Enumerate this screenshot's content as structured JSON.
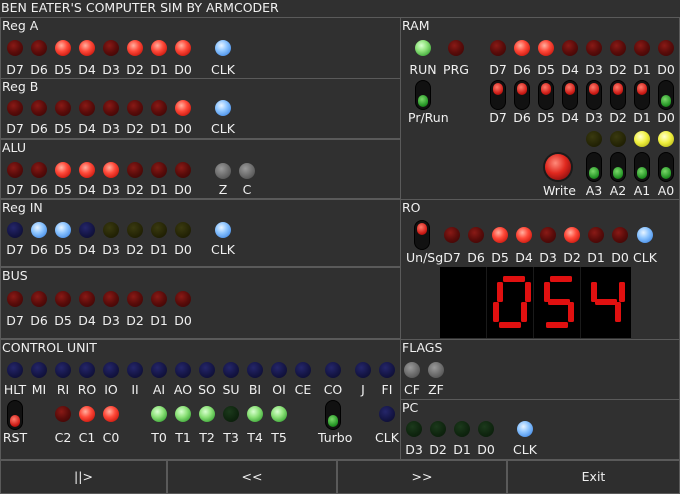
{
  "app": {
    "title": "BEN EATER'S COMPUTER SIM BY ARMCODER"
  },
  "colors": {
    "led_red_on": "#ff4a3a",
    "led_blue_on": "#8cc4ff",
    "led_green_on": "#8ee27a",
    "led_yellow_on": "#f0f040",
    "display_red": "#e01010",
    "background": "#303030"
  },
  "bit_labels": [
    "D7",
    "D6",
    "D5",
    "D4",
    "D3",
    "D2",
    "D1",
    "D0"
  ],
  "reg_a": {
    "title": "Reg A",
    "bits": [
      0,
      0,
      1,
      1,
      0,
      1,
      1,
      1
    ],
    "clk_label": "CLK",
    "clk": 1
  },
  "reg_b": {
    "title": "Reg B",
    "bits": [
      0,
      0,
      0,
      0,
      0,
      0,
      0,
      1
    ],
    "clk_label": "CLK",
    "clk": 1
  },
  "alu": {
    "title": "ALU",
    "bits": [
      0,
      0,
      1,
      1,
      1,
      0,
      0,
      0
    ],
    "z_label": "Z",
    "c_label": "C"
  },
  "reg_in": {
    "title": "Reg IN",
    "bits": [
      0,
      1,
      1,
      0,
      0,
      0,
      0,
      0
    ],
    "clk_label": "CLK",
    "clk": 1
  },
  "bus": {
    "title": "BUS",
    "bits": [
      0,
      0,
      0,
      0,
      0,
      0,
      0,
      0
    ]
  },
  "ram": {
    "title": "RAM",
    "run_label": "RUN",
    "prg_label": "PRG",
    "data_bits": [
      0,
      1,
      1,
      0,
      0,
      0,
      0,
      0
    ],
    "switch_bits": [
      1,
      1,
      1,
      1,
      1,
      1,
      1,
      0
    ],
    "pr_run_label": "Pr/Run",
    "write_label": "Write",
    "addr_labels": [
      "A3",
      "A2",
      "A1",
      "A0"
    ],
    "addr_bits": [
      0,
      0,
      1,
      1
    ]
  },
  "ro": {
    "title": "RO",
    "unsg_label": "Un/Sg",
    "bits": [
      0,
      0,
      1,
      1,
      0,
      1,
      0,
      0
    ],
    "clk_label": "CLK",
    "display_digits": [
      "",
      "0",
      "5",
      "4"
    ]
  },
  "control": {
    "title": "CONTROL UNIT",
    "signals": [
      "HLT",
      "MI",
      "RI",
      "RO",
      "IO",
      "II",
      "AI",
      "AO",
      "SO",
      "SU",
      "BI",
      "OI",
      "CE",
      "CO",
      "J",
      "FI"
    ],
    "rst_label": "RST",
    "counter_labels": [
      "C2",
      "C1",
      "C0"
    ],
    "counter_bits": [
      0,
      1,
      1
    ],
    "t_labels": [
      "T0",
      "T1",
      "T2",
      "T3",
      "T4",
      "T5"
    ],
    "t_bits": [
      1,
      1,
      1,
      0,
      1,
      1
    ],
    "turbo_label": "Turbo",
    "clk_label": "CLK"
  },
  "flags": {
    "title": "FLAGS",
    "labels": [
      "CF",
      "ZF"
    ]
  },
  "pc": {
    "title": "PC",
    "labels": [
      "D3",
      "D2",
      "D1",
      "D0"
    ],
    "bits": [
      0,
      0,
      0,
      0
    ],
    "clk_label": "CLK"
  },
  "buttons": {
    "step": "||>",
    "back": "<<",
    "forward": ">>",
    "exit": "Exit"
  }
}
